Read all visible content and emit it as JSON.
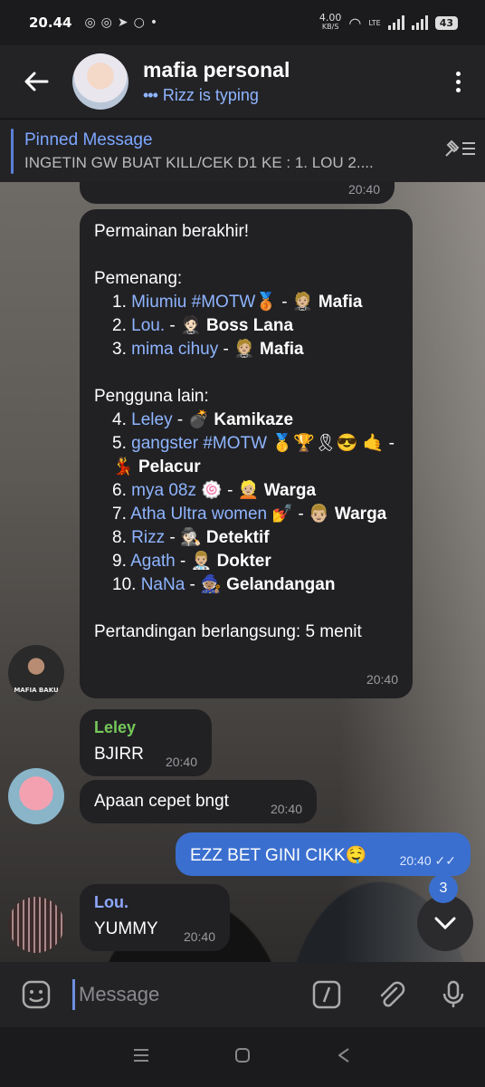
{
  "status_bar": {
    "time": "20.44",
    "net_speed": "4.00",
    "net_unit": "KB/S",
    "network": "LTE",
    "battery": "43"
  },
  "header": {
    "title": "mafia personal",
    "subtitle": "Rizz is typing",
    "back_icon": "arrow-left-icon",
    "menu_icon": "kebab-icon"
  },
  "pinned": {
    "title": "Pinned Message",
    "text": "INGETIN GW BUAT KILL/CEK D1 KE : 1. LOU 2...."
  },
  "messages": {
    "top": {
      "time": "20:40"
    },
    "game": {
      "line1": "Permainan berakhir!",
      "winners_label": "Pemenang:",
      "winners": [
        {
          "num": "1.",
          "name": "Miumiu #MOTW🥉",
          "sep": " - 🤵🏼",
          "role": "Mafia"
        },
        {
          "num": "2.",
          "name": "Lou.",
          "sep": " - 🤵🏻",
          "role": "Boss Lana"
        },
        {
          "num": "3.",
          "name": "mima cihuy",
          "sep": " - 🤵🏼",
          "role": "Mafia"
        }
      ],
      "others_label": "Pengguna lain:",
      "others": [
        {
          "num": "4.",
          "name": "Leley",
          "sep": " - 💣",
          "role": "Kamikaze"
        },
        {
          "num": "5.",
          "name": "gangster #MOTW",
          "sep": " 🥇🏆🎗😎 🤙 - 💃",
          "role": "Pelacur"
        },
        {
          "num": "6.",
          "name": "mya 08z",
          "sep": " 🍥 - 👱🏼",
          "role": "Warga"
        },
        {
          "num": "7.",
          "name": "Atha Ultra women",
          "sep": " 💅 - 👨🏼",
          "role": "Warga"
        },
        {
          "num": "8.",
          "name": "Rizz",
          "sep": " - 🕵🏻",
          "role": "Detektif"
        },
        {
          "num": "9.",
          "name": "Agath",
          "sep": " - 👨🏼‍⚕️",
          "role": "Dokter"
        },
        {
          "num": "10.",
          "name": "NaNa",
          "sep": " - 🧙🏽",
          "role": "Gelandangan"
        }
      ],
      "footer": "Pertandingan berlangsung: 5 menit",
      "time": "20:40"
    },
    "leley": {
      "name": "Leley",
      "text": "BJIRR",
      "time": "20:40"
    },
    "apaan": {
      "text": "Apaan cepet bngt",
      "time": "20:40"
    },
    "ezz": {
      "text": "EZZ BET GINI CIKK🤤",
      "time": "20:40"
    },
    "lou": {
      "name": "Lou.",
      "text": "YUMMY",
      "time": "20:40"
    }
  },
  "mafia_avatar_text": "MAFIA BAKU",
  "unread_badge": "3",
  "input": {
    "placeholder": "Message"
  },
  "colors": {
    "accent": "#3a6fcf",
    "link": "#8fb5ff",
    "leley_name": "#76c85a",
    "bubble": "#212124"
  }
}
